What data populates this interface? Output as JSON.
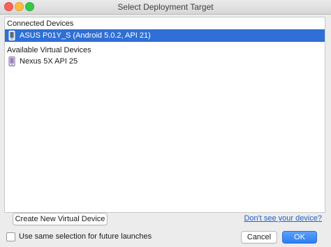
{
  "window": {
    "title": "Select Deployment Target"
  },
  "connected": {
    "header": "Connected Devices",
    "devices": [
      {
        "label": "ASUS P01Y_S (Android 5.0.2, API 21)",
        "icon": "phone-icon",
        "selected": true
      }
    ]
  },
  "virtual": {
    "header": "Available Virtual Devices",
    "devices": [
      {
        "label": "Nexus 5X API 25",
        "icon": "phone-icon",
        "selected": false
      }
    ]
  },
  "buttons": {
    "create_label": "Create New Virtual Device",
    "help_link": "Don't see your device?",
    "cancel_label": "Cancel",
    "ok_label": "OK"
  },
  "checkbox": {
    "label": "Use same selection for future launches",
    "checked": false
  },
  "colors": {
    "selection": "#2f6fd6",
    "link": "#2060c8",
    "ok_button": "#2f7ef0"
  }
}
